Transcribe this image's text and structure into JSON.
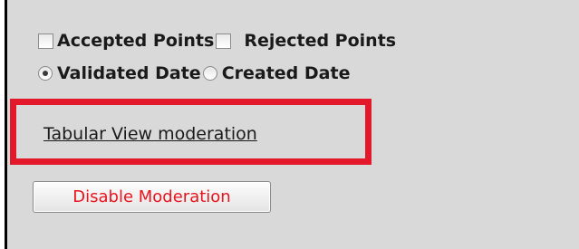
{
  "filters": {
    "accepted_points_label": "Accepted Points",
    "rejected_points_label": "Rejected Points",
    "accepted_points_checked": false,
    "rejected_points_checked": false,
    "validated_date_label": "Validated Date",
    "created_date_label": "Created Date",
    "selected_date_option": "Validated Date"
  },
  "links": {
    "tabular_view_label": "Tabular View moderation"
  },
  "actions": {
    "disable_moderation_label": "Disable Moderation"
  },
  "colors": {
    "highlight_border": "#e3182a",
    "button_text": "#e8141e",
    "background": "#d9d9d9"
  }
}
